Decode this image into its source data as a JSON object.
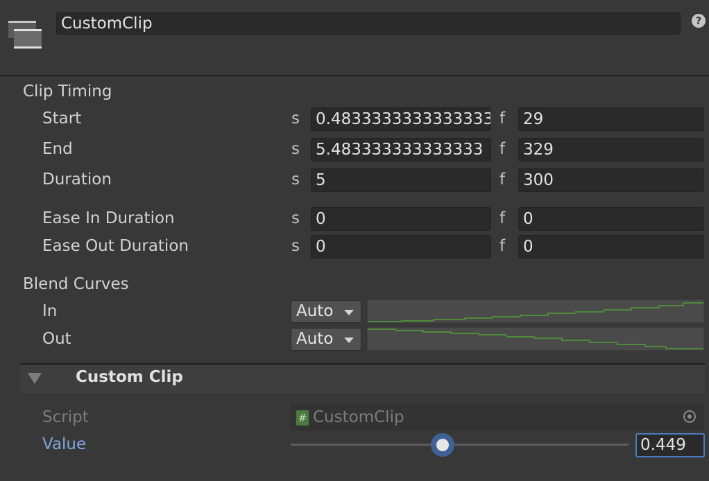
{
  "clip": {
    "name": "CustomClip",
    "help_icon": "help-icon",
    "help_glyph": "?"
  },
  "clip_timing": {
    "heading": "Clip Timing",
    "seconds_unit": "s",
    "frames_unit": "f",
    "rows": [
      {
        "label": "Start",
        "seconds": "0.4833333333333333",
        "frames": "29"
      },
      {
        "label": "End",
        "seconds": "5.483333333333333",
        "frames": "329"
      },
      {
        "label": "Duration",
        "seconds": "5",
        "frames": "300"
      },
      {
        "label": "Ease In Duration",
        "seconds": "0",
        "frames": "0"
      },
      {
        "label": "Ease Out Duration",
        "seconds": "0",
        "frames": "0"
      }
    ]
  },
  "blend_curves": {
    "heading": "Blend Curves",
    "in": {
      "label": "In",
      "mode": "Auto"
    },
    "out": {
      "label": "Out",
      "mode": "Auto"
    },
    "curve_color": "#4e8a3a"
  },
  "custom_clip": {
    "title": "Custom Clip",
    "script_label": "Script",
    "script_name": "CustomClip",
    "script_icon_glyph": "#",
    "value_label": "Value",
    "value": "0.449",
    "slider_fraction": 0.449
  },
  "colors": {
    "accent": "#4a7bc0",
    "value_label": "#7fa6e0",
    "background": "#383838"
  }
}
